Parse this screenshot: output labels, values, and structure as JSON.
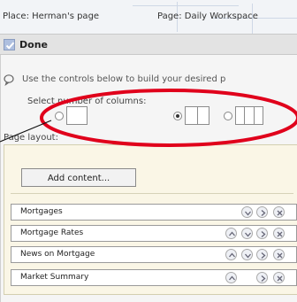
{
  "breadcrumb": {
    "place": "Place: Herman's page",
    "page": "Page: Daily Workspace"
  },
  "done_label": "Done",
  "hint": "Use the controls below to build your desired p",
  "columns": {
    "label": "Select number of columns:",
    "selected": 2
  },
  "layout": {
    "label": "Page layout:",
    "add_button": "Add content...",
    "rows": [
      {
        "label": "Mortgages"
      },
      {
        "label": "Mortgage Rates"
      },
      {
        "label": "News on Mortgage"
      },
      {
        "label": "Market Summary"
      }
    ]
  },
  "colors": {
    "annotation": "#e0001b",
    "layout_bg": "#faf6e6",
    "done_bar": "#e3e3e3"
  },
  "icons": {
    "hint": "question-bubble-icon",
    "row_controls": [
      "move-up-icon",
      "move-down-icon",
      "move-right-icon",
      "remove-icon"
    ]
  }
}
